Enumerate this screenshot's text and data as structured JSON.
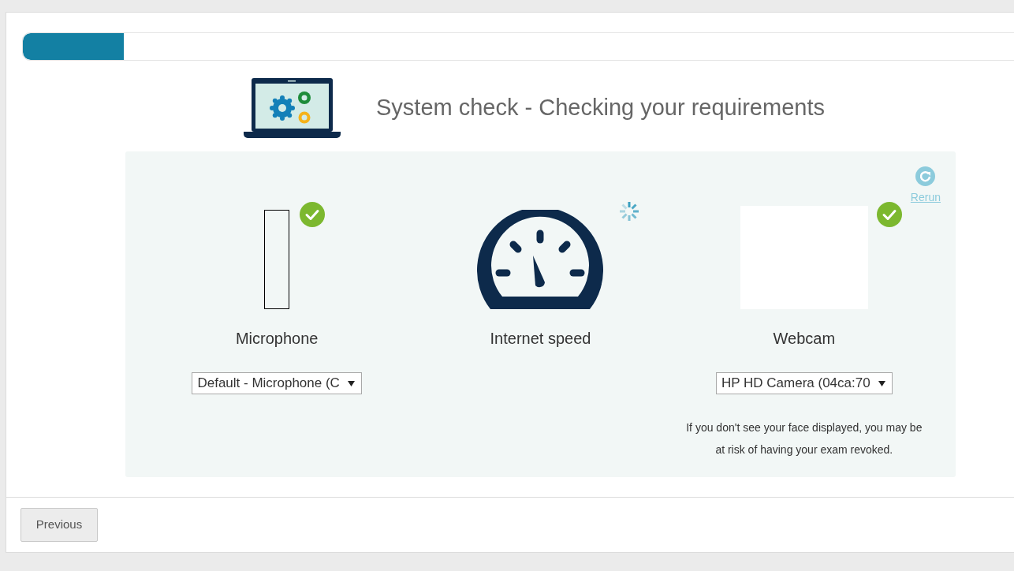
{
  "progress": {
    "level": 0.1
  },
  "header": {
    "title": "System check - Checking your requirements"
  },
  "rerun": {
    "label": "Rerun"
  },
  "checks": [
    {
      "kind": "meter",
      "label": "Microphone",
      "passed": true,
      "level": 0,
      "device": "Default - Microphone (C"
    },
    {
      "kind": "gauge",
      "label": "Internet speed",
      "passed": false
    },
    {
      "kind": "camera",
      "label": "Webcam",
      "passed": true,
      "device": "HP HD Camera (04ca:70",
      "note": "If you don't see your face displayed, you may be at risk of having your exam revoked."
    }
  ],
  "footer": {
    "buttons": [
      "Previous"
    ]
  }
}
